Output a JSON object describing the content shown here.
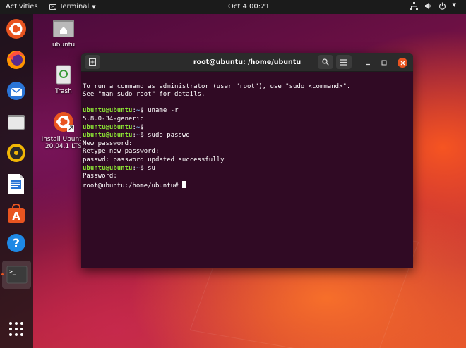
{
  "topbar": {
    "activities": "Activities",
    "app_name": "Terminal",
    "clock": "Oct 4  00:21"
  },
  "dock": {
    "items": [
      "Ubuntu Software Center",
      "Firefox",
      "Thunderbird",
      "Files",
      "Rhythmbox",
      "LibreOffice Writer",
      "Ubuntu Software",
      "Help",
      "Terminal",
      "Show Applications"
    ]
  },
  "desktop": {
    "icons": [
      {
        "label": "ubuntu"
      },
      {
        "label": "Trash"
      },
      {
        "label_line1": "Install Ubuntu",
        "label_line2": "20.04.1 LTS"
      }
    ]
  },
  "terminal": {
    "title": "root@ubuntu: /home/ubuntu",
    "lines": [
      {
        "text": "To run a command as administrator (user \"root\"), use \"sudo <command>\"."
      },
      {
        "text": "See \"man sudo_root\" for details."
      },
      {
        "text": ""
      },
      {
        "user": "ubuntu@ubuntu",
        "path": "~",
        "cmd": "uname -r"
      },
      {
        "text": "5.8.0-34-generic"
      },
      {
        "user": "ubuntu@ubuntu",
        "path": "~",
        "cmd": ""
      },
      {
        "user": "ubuntu@ubuntu",
        "path": "~",
        "cmd": "sudo passwd"
      },
      {
        "text": "New password:"
      },
      {
        "text": "Retype new password:"
      },
      {
        "text": "passwd: password updated successfully"
      },
      {
        "user": "ubuntu@ubuntu",
        "path": "~",
        "cmd": "su"
      },
      {
        "text": "Password:"
      },
      {
        "text": "root@ubuntu:/home/ubuntu# "
      }
    ]
  },
  "colors": {
    "terminal_bg": "#300a24",
    "prompt_user": "#8ae234",
    "prompt_path": "#729fcf",
    "accent": "#e95420"
  }
}
